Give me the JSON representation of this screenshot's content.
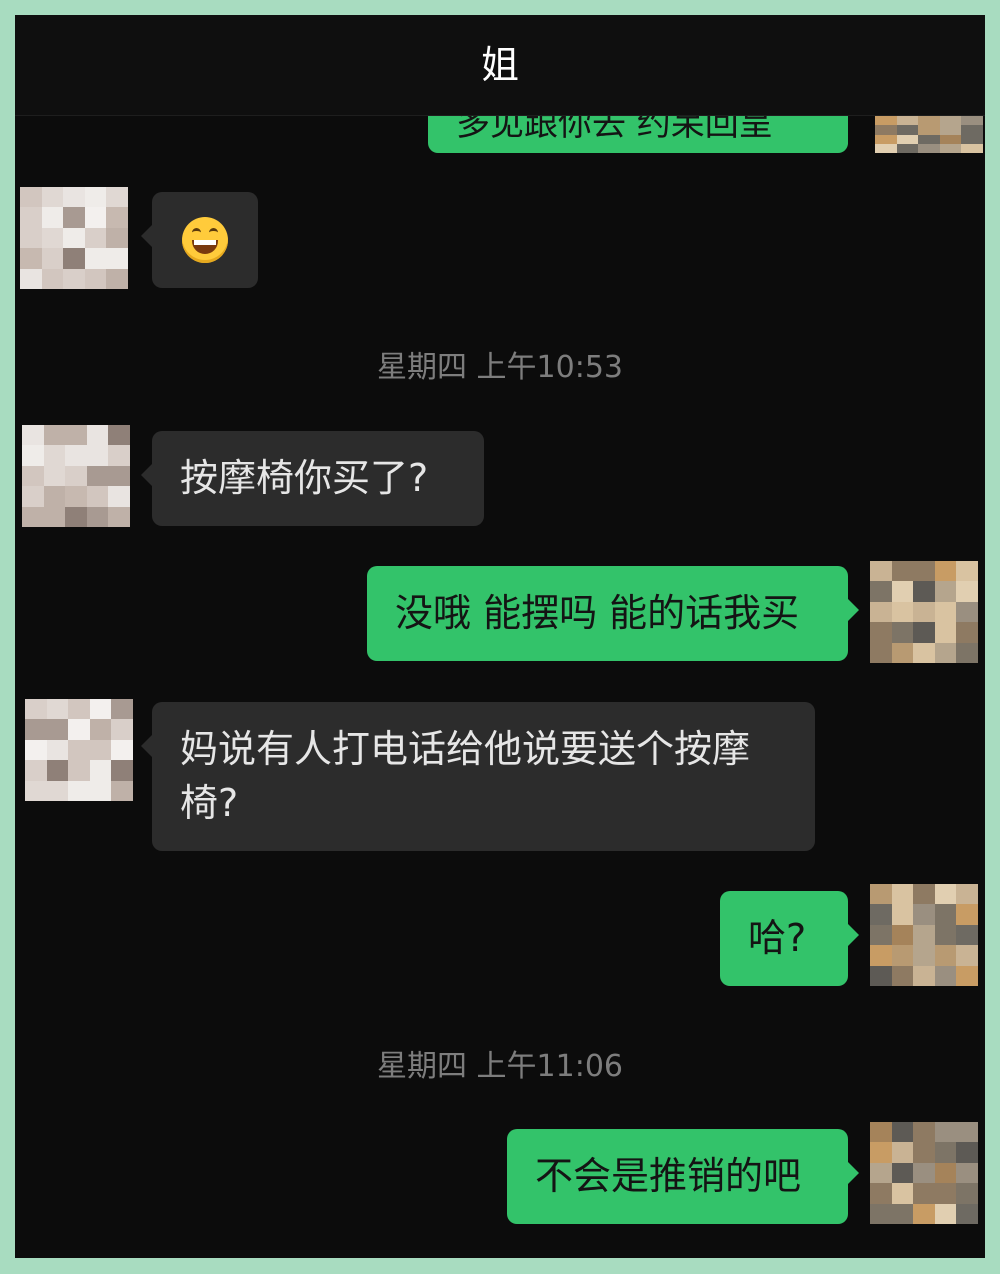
{
  "header": {
    "title": "姐"
  },
  "colors": {
    "sent_bubble": "#33c36a",
    "received_bubble": "#2c2c2c",
    "background": "#0c0c0c"
  },
  "messages": [
    {
      "side": "right",
      "text": "多见跟你去 约呆回呈",
      "note_partially_hidden": true
    },
    {
      "side": "left",
      "emoji": "grinning-face-icon"
    },
    {
      "side": "left",
      "text": "按摩椅你买了?"
    },
    {
      "side": "right",
      "text": "没哦 能摆吗 能的话我买"
    },
    {
      "side": "left",
      "text": "妈说有人打电话给他说要送个按摩椅?"
    },
    {
      "side": "right",
      "text": "哈?"
    },
    {
      "side": "right",
      "text": "不会是推销的吧"
    }
  ],
  "timestamps": [
    "星期四 上午10:53",
    "星期四 上午11:06"
  ]
}
